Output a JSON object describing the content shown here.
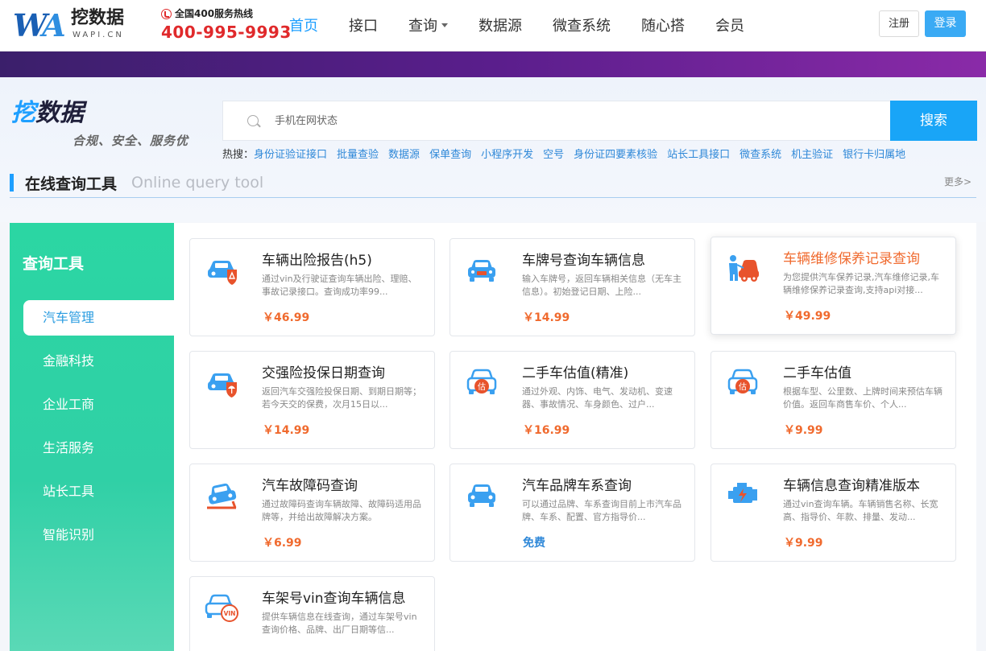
{
  "header": {
    "logo_mark": "WA",
    "logo_cn": "挖数据",
    "logo_en": "WAPI.CN",
    "hotline_label": "全国400服务热线",
    "hotline_number": "400-995-9993",
    "nav": [
      {
        "label": "首页",
        "active": true
      },
      {
        "label": "接口"
      },
      {
        "label": "查询",
        "dropdown": true
      },
      {
        "label": "数据源"
      },
      {
        "label": "微查系统"
      },
      {
        "label": "随心搭"
      },
      {
        "label": "会员"
      }
    ],
    "register": "注册",
    "login": "登录"
  },
  "search": {
    "brand_a": "挖",
    "brand_b": "数据",
    "slogan": "合规、安全、服务优",
    "placeholder": "手机在网状态",
    "button": "搜索",
    "hot_label": "热搜：",
    "hot_links": [
      "身份证验证接口",
      "批量查验",
      "数据源",
      "保单查询",
      "小程序开发",
      "空号",
      "身份证四要素核验",
      "站长工具接口",
      "微查系统",
      "机主验证",
      "银行卡归属地"
    ]
  },
  "section": {
    "title_cn": "在线查询工具",
    "title_en": "Online query tool",
    "more": "更多>"
  },
  "sidebar": {
    "title": "查询工具",
    "items": [
      {
        "label": "汽车管理",
        "active": true
      },
      {
        "label": "金融科技"
      },
      {
        "label": "企业工商"
      },
      {
        "label": "生活服务"
      },
      {
        "label": "站长工具"
      },
      {
        "label": "智能识别"
      }
    ]
  },
  "cards": [
    {
      "title": "车辆出险报告(h5)",
      "desc": "通过vin及行驶证查询车辆出险、理赔、事故记录接口。查询成功率99...",
      "price": "￥46.99",
      "icon": "car-accident-icon"
    },
    {
      "title": "车牌号查询车辆信息",
      "desc": "输入车牌号，返回车辆相关信息（无车主信息）。初始登记日期、上险...",
      "price": "￥14.99",
      "icon": "car-plate-icon"
    },
    {
      "title": "车辆维修保养记录查询",
      "desc": "为您提供汽车保养记录,汽车维修记录,车辆维修保养记录查询,支持api对接...",
      "price": "￥49.99",
      "icon": "car-repair-icon",
      "hover": true
    },
    {
      "title": "交强险投保日期查询",
      "desc": "返回汽车交强险投保日期、到期日期等；若今天交的保费，次月15日以...",
      "price": "￥14.99",
      "icon": "car-insurance-icon"
    },
    {
      "title": "二手车估值(精准)",
      "desc": "通过外观、内饰、电气、发动机、变速器、事故情况、车身颜色、过户...",
      "price": "￥16.99",
      "icon": "car-valuation-icon"
    },
    {
      "title": "二手车估值",
      "desc": "根据车型、公里数、上牌时间来预估车辆价值。返回车商售车价、个人...",
      "price": "￥9.99",
      "icon": "car-valuation-icon"
    },
    {
      "title": "汽车故障码查询",
      "desc": "通过故障码查询车辆故障、故障码适用品牌等，并给出故障解决方案。",
      "price": "￥6.99",
      "icon": "car-fault-icon"
    },
    {
      "title": "汽车品牌车系查询",
      "desc": "可以通过品牌、车系查询目前上市汽车品牌、车系、配置、官方指导价...",
      "price": "免费",
      "icon": "car-brand-icon",
      "free": true
    },
    {
      "title": "车辆信息查询精准版本",
      "desc": "通过vin查询车辆。车辆销售名称、长宽高、指导价、年款、排量、发动...",
      "price": "￥9.99",
      "icon": "engine-icon"
    },
    {
      "title": "车架号vin查询车辆信息",
      "desc": "提供车辆信息在线查询，通过车架号vin查询价格、品牌、出厂日期等信...",
      "price": "",
      "icon": "car-vin-icon"
    }
  ]
}
